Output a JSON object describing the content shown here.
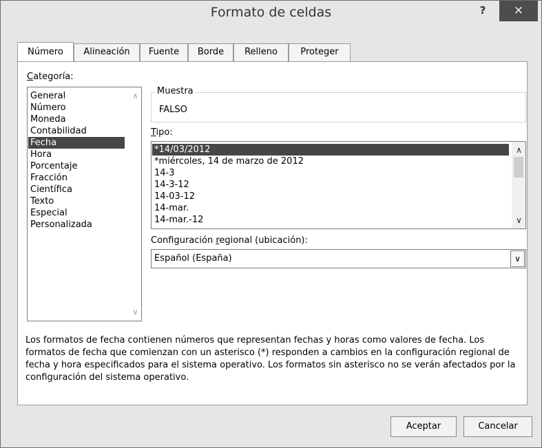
{
  "window": {
    "title": "Formato de celdas",
    "help_label": "?",
    "close_label": "×"
  },
  "tabs": [
    {
      "label": "Número",
      "active": true
    },
    {
      "label": "Alineación",
      "active": false
    },
    {
      "label": "Fuente",
      "active": false
    },
    {
      "label": "Borde",
      "active": false
    },
    {
      "label": "Relleno",
      "active": false
    },
    {
      "label": "Proteger",
      "active": false
    }
  ],
  "category": {
    "label_accel": "C",
    "label_rest": "ategoría:",
    "items": [
      "General",
      "Número",
      "Moneda",
      "Contabilidad",
      "Fecha",
      "Hora",
      "Porcentaje",
      "Fracción",
      "Científica",
      "Texto",
      "Especial",
      "Personalizada"
    ],
    "selected": "Fecha"
  },
  "sample": {
    "label": "Muestra",
    "value": "FALSO"
  },
  "type": {
    "label_accel": "T",
    "label_rest": "ipo:",
    "items": [
      "*14/03/2012",
      "*miércoles, 14 de marzo de 2012",
      "14-3",
      "14-3-12",
      "14-03-12",
      "14-mar.",
      "14-mar.-12"
    ],
    "selected": "*14/03/2012"
  },
  "locale": {
    "label_before": "Configuración ",
    "label_accel": "r",
    "label_after": "egional (ubicación):",
    "value": "Español (España)"
  },
  "description": "Los formatos de fecha contienen números que representan fechas y horas como valores de fecha. Los formatos de fecha que comienzan con un asterisco (*) responden a cambios en la configuración regional de fecha y hora especificados para el sistema operativo. Los formatos sin asterisco no se verán afectados por la configuración del sistema operativo.",
  "buttons": {
    "ok": "Aceptar",
    "cancel": "Cancelar"
  },
  "icons": {
    "scroll_up": "chevron-up-icon",
    "scroll_down": "chevron-down-icon",
    "dropdown": "chevron-down-icon"
  }
}
